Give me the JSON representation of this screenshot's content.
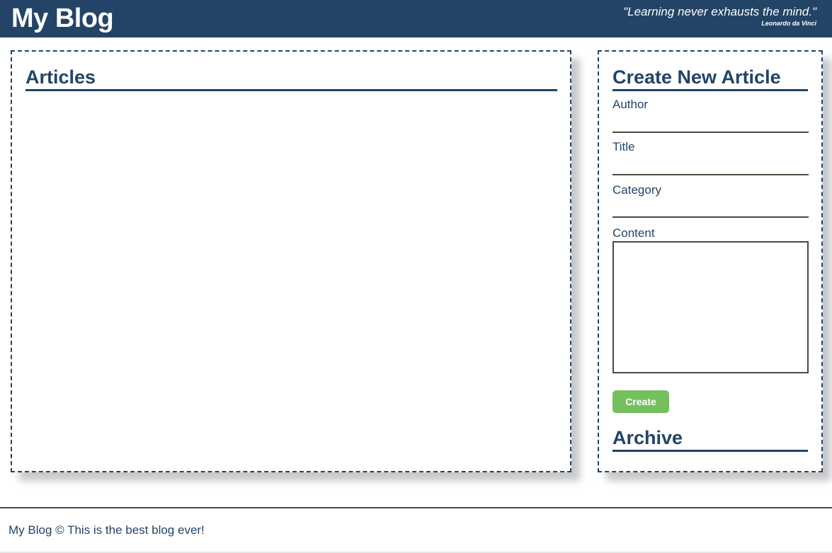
{
  "header": {
    "logo": "My Blog",
    "quote_text": "\"Learning never exhausts the mind.\"",
    "quote_author": "Leonardo da Vinci"
  },
  "articles": {
    "heading": "Articles"
  },
  "create_form": {
    "heading": "Create New Article",
    "author_label": "Author",
    "author_value": "",
    "title_label": "Title",
    "title_value": "",
    "category_label": "Category",
    "category_value": "",
    "content_label": "Content",
    "content_value": "",
    "submit_label": "Create"
  },
  "archive": {
    "heading": "Archive"
  },
  "footer": {
    "text": "My Blog © This is the best blog ever!"
  },
  "colors": {
    "primary": "#234466",
    "button": "#74c05e",
    "input_border": "#4a4a3e"
  }
}
